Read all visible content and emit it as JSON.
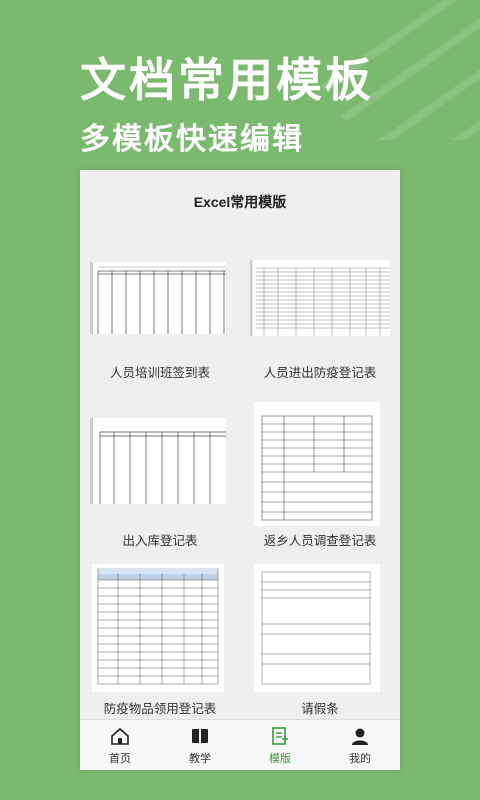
{
  "promo": {
    "headline": "文档常用模板",
    "subline": "多模板快速编辑"
  },
  "app": {
    "title": "Excel常用模版",
    "templates": [
      {
        "label": "人员培训班签到表"
      },
      {
        "label": "人员进出防疫登记表"
      },
      {
        "label": "出入库登记表"
      },
      {
        "label": "返乡人员调查登记表"
      },
      {
        "label": "防疫物品领用登记表"
      },
      {
        "label": "请假条"
      }
    ],
    "tabs": [
      {
        "label": "首页",
        "icon": "home-icon"
      },
      {
        "label": "教学",
        "icon": "book-icon"
      },
      {
        "label": "模版",
        "icon": "template-doc-icon",
        "active": true
      },
      {
        "label": "我的",
        "icon": "user-icon"
      }
    ],
    "accent": "#3b9b3b",
    "background": "#7cb970"
  }
}
